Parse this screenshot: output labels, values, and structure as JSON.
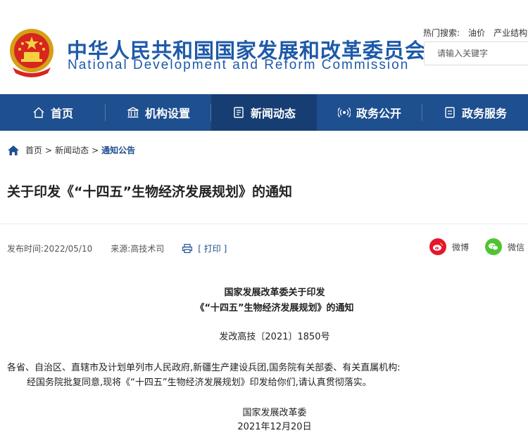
{
  "header": {
    "title_cn": "中华人民共和国国家发展和改革委员会",
    "title_en": "National Development and Reform Commission",
    "hot_label": "热门搜索:",
    "hot_items": [
      "油价",
      "产业结构"
    ],
    "search_placeholder": "请输入关键字"
  },
  "nav": {
    "items": [
      {
        "label": "首页",
        "icon": "home-outline-icon"
      },
      {
        "label": "机构设置",
        "icon": "institution-building-icon"
      },
      {
        "label": "新闻动态",
        "icon": "news-document-icon"
      },
      {
        "label": "政务公开",
        "icon": "broadcast-icon"
      },
      {
        "label": "政务服务",
        "icon": "service-document-icon"
      }
    ],
    "active_index": 2
  },
  "breadcrumb": {
    "items": [
      "首页",
      "新闻动态",
      "通知公告"
    ],
    "separator": ">"
  },
  "article": {
    "title": "关于印发《“十四五”生物经济发展规划》的通知",
    "publish_time": "发布时间:2022/05/10",
    "source": "来源:高技术司",
    "print_label": "[ 打印 ]",
    "share": [
      {
        "label": "微博",
        "icon": "weibo-icon",
        "color": "#e6162d"
      },
      {
        "label": "微信",
        "icon": "wechat-icon",
        "color": "#51c332"
      }
    ],
    "heading_line1": "国家发展改革委关于印发",
    "heading_line2": "《“十四五”生物经济发展规划》的通知",
    "doc_number": "发改高技〔2021〕1850号",
    "recipients": "各省、自治区、直辖市及计划单列市人民政府,新疆生产建设兵团,国务院有关部委、有关直属机构:",
    "body": "经国务院批复同意,现将《“十四五”生物经济发展规划》印发给你们,请认真贯彻落实。",
    "signature": "国家发展改革委",
    "date": "2021年12月20日"
  },
  "colors": {
    "brand_blue": "#1e5aa8",
    "nav_bg": "#1e4f8f",
    "nav_active": "#163e73"
  }
}
